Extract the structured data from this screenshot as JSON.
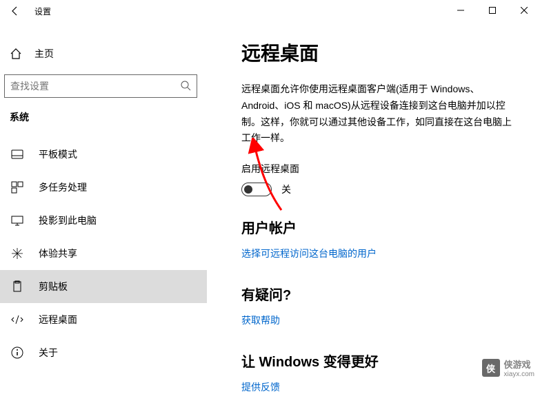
{
  "window": {
    "title": "设置"
  },
  "sidebar": {
    "home": "主页",
    "search_placeholder": "查找设置",
    "category": "系统",
    "items": [
      {
        "label": "平板模式",
        "icon": "tablet"
      },
      {
        "label": "多任务处理",
        "icon": "multitask"
      },
      {
        "label": "投影到此电脑",
        "icon": "project"
      },
      {
        "label": "体验共享",
        "icon": "share"
      },
      {
        "label": "剪贴板",
        "icon": "clipboard"
      },
      {
        "label": "远程桌面",
        "icon": "remote"
      },
      {
        "label": "关于",
        "icon": "about"
      }
    ]
  },
  "main": {
    "title": "远程桌面",
    "description": "远程桌面允许你使用远程桌面客户端(适用于 Windows、Android、iOS 和 macOS)从远程设备连接到这台电脑并加以控制。这样，你就可以通过其他设备工作，如同直接在这台电脑上工作一样。",
    "enable_label": "启用远程桌面",
    "toggle_state": "关",
    "accounts_title": "用户帐户",
    "accounts_link": "选择可远程访问这台电脑的用户",
    "help_title": "有疑问?",
    "help_link": "获取帮助",
    "better_title": "让 Windows 变得更好",
    "feedback_link": "提供反馈"
  },
  "watermark": {
    "text": "侠游戏",
    "url": "xiayx.com"
  }
}
